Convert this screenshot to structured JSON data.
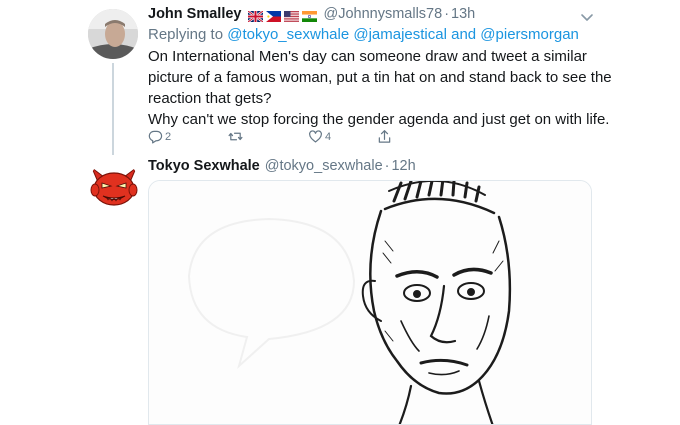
{
  "tweet1": {
    "author_name": "John Smalley",
    "handle": "@Johnnysmalls78",
    "separator": "·",
    "time": "13h",
    "flags": [
      "uk-flag",
      "philippines-flag",
      "usa-flag",
      "india-flag"
    ],
    "reply_prefix": "Replying to",
    "reply_to": "@tokyo_sexwhale @jamajestical and @piersmorgan",
    "text_line1": "On International Men's day can someone draw and tweet a similar",
    "text_line2": "picture of a famous woman, put a tin hat on and stand back to see the",
    "text_line3": "reaction that gets?",
    "text_line4": "Why can't we stop forcing the gender agenda and just get on with life.",
    "reply_count": "2",
    "retweet_count": "",
    "like_count": "4"
  },
  "tweet2": {
    "author_name": "Tokyo Sexwhale",
    "handle": "@tokyo_sexwhale",
    "separator": "·",
    "time": "12h"
  },
  "colors": {
    "link": "#1b95e0",
    "muted": "#657786",
    "text": "#14171a",
    "border": "#e1e8ed"
  }
}
